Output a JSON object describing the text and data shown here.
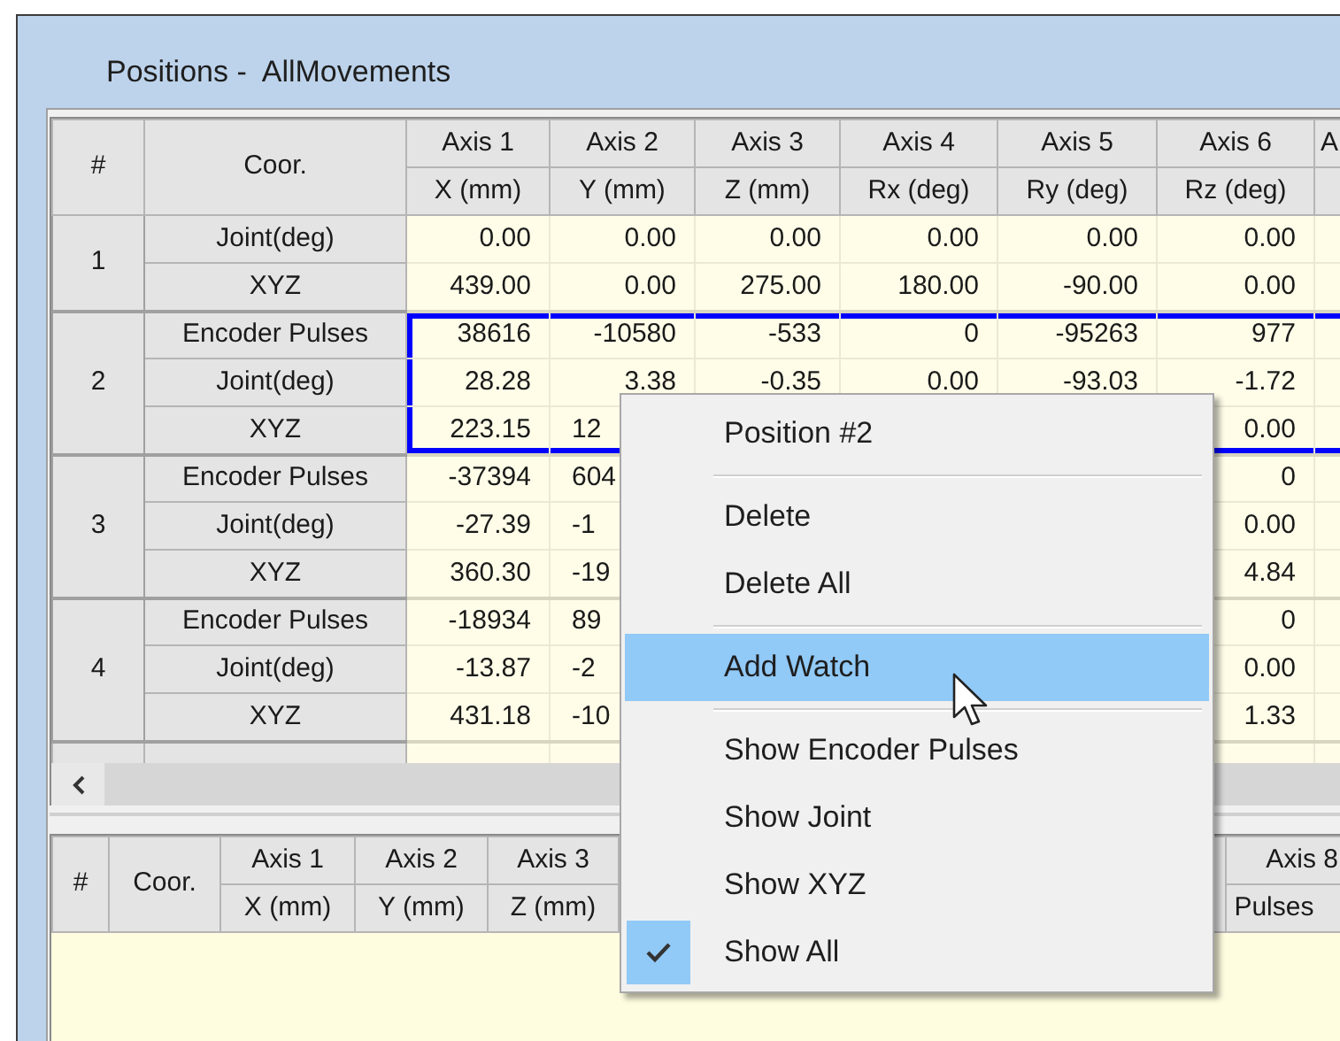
{
  "window": {
    "title": "Positions -  AllMovements"
  },
  "positions_grid": {
    "columns": [
      {
        "top": "#"
      },
      {
        "top": "Coor."
      },
      {
        "top": "Axis 1",
        "bottom": "X (mm)"
      },
      {
        "top": "Axis 2",
        "bottom": "Y (mm)"
      },
      {
        "top": "Axis 3",
        "bottom": "Z (mm)"
      },
      {
        "top": "Axis 4",
        "bottom": "Rx (deg)"
      },
      {
        "top": "Axis 5",
        "bottom": "Ry (deg)"
      },
      {
        "top": "Axis 6",
        "bottom": "Rz (deg)"
      },
      {
        "top": "A"
      }
    ],
    "positions": [
      {
        "number": "1",
        "selected": false,
        "rows": [
          {
            "coor": "Joint(deg)",
            "values": [
              "0.00",
              "0.00",
              "0.00",
              "0.00",
              "0.00",
              "0.00"
            ]
          },
          {
            "coor": "XYZ",
            "values": [
              "439.00",
              "0.00",
              "275.00",
              "180.00",
              "-90.00",
              "0.00"
            ]
          }
        ]
      },
      {
        "number": "2",
        "selected": true,
        "rows": [
          {
            "coor": "Encoder Pulses",
            "values": [
              "38616",
              "-10580",
              "-533",
              "0",
              "-95263",
              "977"
            ]
          },
          {
            "coor": "Joint(deg)",
            "values": [
              "28.28",
              "3.38",
              "-0.35",
              "0.00",
              "-93.03",
              "-1.72"
            ]
          },
          {
            "coor": "XYZ",
            "values": [
              "223.15",
              "12"
            ],
            "end_values": [
              "0.00"
            ]
          }
        ]
      },
      {
        "number": "3",
        "selected": false,
        "rows": [
          {
            "coor": "Encoder Pulses",
            "values": [
              "-37394",
              "604"
            ],
            "end_values": [
              "0"
            ]
          },
          {
            "coor": "Joint(deg)",
            "values": [
              "-27.39",
              "-1"
            ],
            "end_values": [
              "0.00"
            ]
          },
          {
            "coor": "XYZ",
            "values": [
              "360.30",
              "-19"
            ],
            "end_values": [
              "4.84"
            ]
          }
        ]
      },
      {
        "number": "4",
        "selected": false,
        "rows": [
          {
            "coor": "Encoder Pulses",
            "values": [
              "-18934",
              "89"
            ],
            "end_values": [
              "0"
            ]
          },
          {
            "coor": "Joint(deg)",
            "values": [
              "-13.87",
              "-2"
            ],
            "end_values": [
              "0.00"
            ]
          },
          {
            "coor": "XYZ",
            "values": [
              "431.18",
              "-10"
            ],
            "end_values": [
              "1.33"
            ]
          }
        ]
      }
    ]
  },
  "watch_grid": {
    "columns": [
      {
        "top": "#"
      },
      {
        "top": "Coor."
      },
      {
        "top": "Axis 1",
        "bottom": "X (mm)"
      },
      {
        "top": "Axis 2",
        "bottom": "Y (mm)"
      },
      {
        "top": "Axis 3",
        "bottom": "Z (mm)"
      }
    ],
    "end_columns": [
      {
        "top": "Axis 8",
        "bottom": "Pulses"
      }
    ]
  },
  "context_menu": {
    "items": [
      {
        "kind": "item",
        "label": "Position #2",
        "selected": false,
        "checked": false
      },
      {
        "kind": "separator"
      },
      {
        "kind": "item",
        "label": "Delete",
        "selected": false,
        "checked": false
      },
      {
        "kind": "item",
        "label": "Delete All",
        "selected": false,
        "checked": false
      },
      {
        "kind": "separator"
      },
      {
        "kind": "item",
        "label": "Add Watch",
        "selected": true,
        "checked": false
      },
      {
        "kind": "separator"
      },
      {
        "kind": "item",
        "label": "Show Encoder Pulses",
        "selected": false,
        "checked": false
      },
      {
        "kind": "item",
        "label": "Show Joint",
        "selected": false,
        "checked": false
      },
      {
        "kind": "item",
        "label": "Show XYZ",
        "selected": false,
        "checked": false
      },
      {
        "kind": "item",
        "label": "Show All",
        "selected": false,
        "checked": true
      }
    ]
  }
}
